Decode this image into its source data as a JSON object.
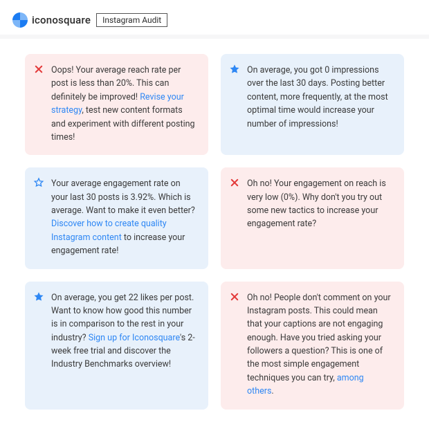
{
  "header": {
    "brand": "iconosquare",
    "tag": "Instagram Audit"
  },
  "cards": {
    "reach_rate": {
      "pre": "Oops! Your average reach rate per post is less than 20%. This can definitely be improved! ",
      "link": "Revise your strategy",
      "post": ", test new content formats and experiment with different posting times!"
    },
    "impressions": {
      "text": "On average, you got 0 impressions over the last 30 days. Posting better content, more frequently, at the most optimal time would increase your number of impressions!"
    },
    "engagement_rate": {
      "pre": "Your average engagement rate on your last 30 posts is 3.92%. Which is average. Want to make it even better? ",
      "link": "Discover how to create quality Instagram content",
      "post": " to increase your engagement rate!"
    },
    "engagement_on_reach": {
      "text": "Oh no! Your engagement on reach is very low (0%). Why don't you try out some new tactics to increase your engagement rate?"
    },
    "likes_per_post": {
      "pre": "On average, you get 22 likes per post. Want to know how good this number is in comparison to the rest in your industry? ",
      "link": "Sign up for Iconosquare",
      "post": "'s 2-week free trial and discover the Industry Benchmarks overview!"
    },
    "comments": {
      "pre": "Oh no! People don't comment on your Instagram posts. This could mean that your captions are not engaging enough. Have you tried asking your followers a question? This is one of the most simple engagement techniques you can try, ",
      "link": "among others",
      "post": "."
    }
  }
}
